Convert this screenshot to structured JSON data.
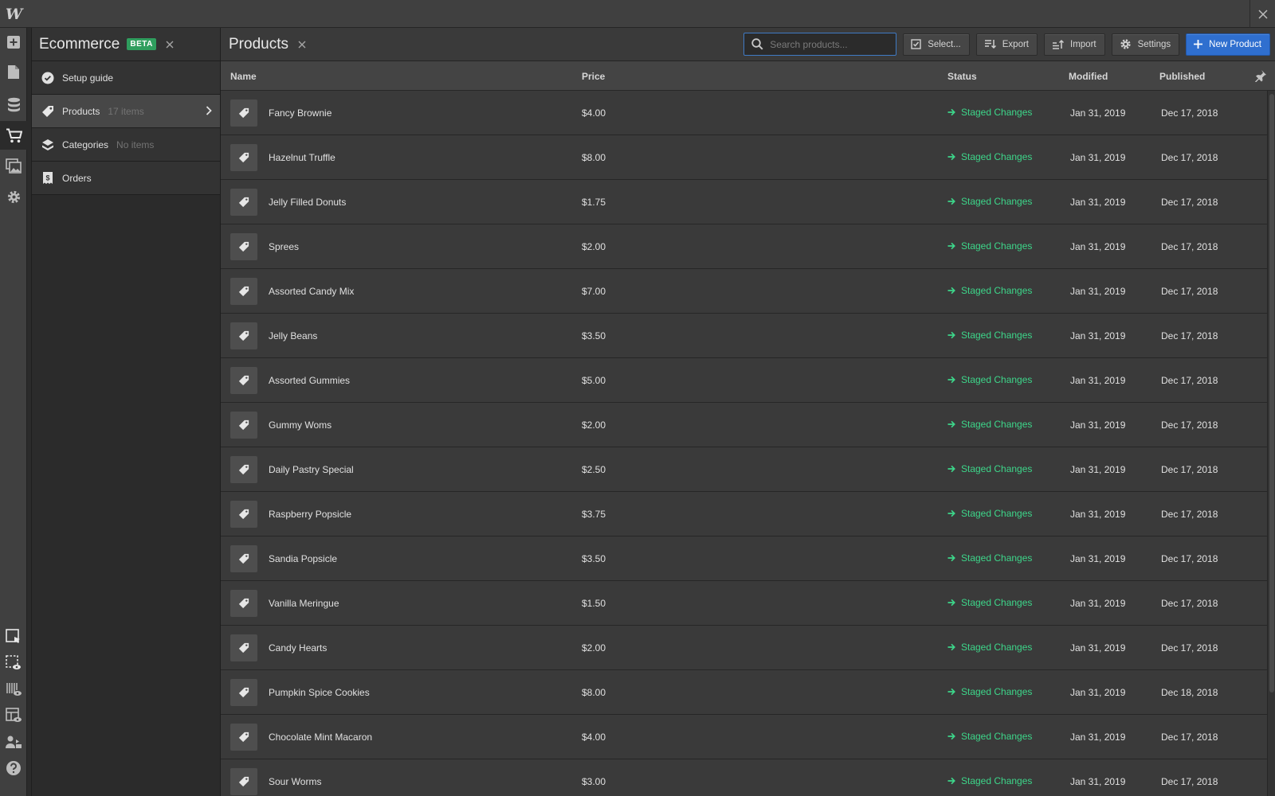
{
  "app": {
    "logo": "W"
  },
  "rail": {
    "icons": [
      "add-icon",
      "pages-icon",
      "cms-icon",
      "ecommerce-icon",
      "assets-icon",
      "settings-icon",
      "select-icon",
      "preview-icon",
      "navigator-icon",
      "layout-icon",
      "audit-icon",
      "help-icon"
    ]
  },
  "panel": {
    "title": "Ecommerce",
    "badge": "BETA",
    "items": [
      {
        "label": "Setup guide",
        "count": ""
      },
      {
        "label": "Products",
        "count": "17 items"
      },
      {
        "label": "Categories",
        "count": "No items"
      },
      {
        "label": "Orders",
        "count": ""
      }
    ]
  },
  "main": {
    "title": "Products",
    "search_placeholder": "Search products...",
    "buttons": {
      "select": "Select...",
      "export": "Export",
      "import": "Import",
      "settings": "Settings",
      "new_product": "New Product"
    }
  },
  "table": {
    "headers": {
      "name": "Name",
      "price": "Price",
      "status": "Status",
      "modified": "Modified",
      "published": "Published"
    },
    "rows": [
      {
        "name": "Fancy Brownie",
        "price": "$4.00",
        "status": "Staged Changes",
        "modified": "Jan 31, 2019",
        "published": "Dec 17, 2018"
      },
      {
        "name": "Hazelnut Truffle",
        "price": "$8.00",
        "status": "Staged Changes",
        "modified": "Jan 31, 2019",
        "published": "Dec 17, 2018"
      },
      {
        "name": "Jelly Filled Donuts",
        "price": "$1.75",
        "status": "Staged Changes",
        "modified": "Jan 31, 2019",
        "published": "Dec 17, 2018"
      },
      {
        "name": "Sprees",
        "price": "$2.00",
        "status": "Staged Changes",
        "modified": "Jan 31, 2019",
        "published": "Dec 17, 2018"
      },
      {
        "name": "Assorted Candy Mix",
        "price": "$7.00",
        "status": "Staged Changes",
        "modified": "Jan 31, 2019",
        "published": "Dec 17, 2018"
      },
      {
        "name": "Jelly Beans",
        "price": "$3.50",
        "status": "Staged Changes",
        "modified": "Jan 31, 2019",
        "published": "Dec 17, 2018"
      },
      {
        "name": "Assorted Gummies",
        "price": "$5.00",
        "status": "Staged Changes",
        "modified": "Jan 31, 2019",
        "published": "Dec 17, 2018"
      },
      {
        "name": "Gummy Woms",
        "price": "$2.00",
        "status": "Staged Changes",
        "modified": "Jan 31, 2019",
        "published": "Dec 17, 2018"
      },
      {
        "name": "Daily Pastry Special",
        "price": "$2.50",
        "status": "Staged Changes",
        "modified": "Jan 31, 2019",
        "published": "Dec 17, 2018"
      },
      {
        "name": "Raspberry Popsicle",
        "price": "$3.75",
        "status": "Staged Changes",
        "modified": "Jan 31, 2019",
        "published": "Dec 17, 2018"
      },
      {
        "name": "Sandia Popsicle",
        "price": "$3.50",
        "status": "Staged Changes",
        "modified": "Jan 31, 2019",
        "published": "Dec 17, 2018"
      },
      {
        "name": "Vanilla Meringue",
        "price": "$1.50",
        "status": "Staged Changes",
        "modified": "Jan 31, 2019",
        "published": "Dec 17, 2018"
      },
      {
        "name": "Candy Hearts",
        "price": "$2.00",
        "status": "Staged Changes",
        "modified": "Jan 31, 2019",
        "published": "Dec 17, 2018"
      },
      {
        "name": "Pumpkin Spice Cookies",
        "price": "$8.00",
        "status": "Staged Changes",
        "modified": "Jan 31, 2019",
        "published": "Dec 18, 2018"
      },
      {
        "name": "Chocolate Mint Macaron",
        "price": "$4.00",
        "status": "Staged Changes",
        "modified": "Jan 31, 2019",
        "published": "Dec 17, 2018"
      },
      {
        "name": "Sour Worms",
        "price": "$3.00",
        "status": "Staged Changes",
        "modified": "Jan 31, 2019",
        "published": "Dec 17, 2018"
      }
    ]
  },
  "colors": {
    "accent": "#2f6fcf",
    "staged": "#3dd68a",
    "beta": "#2f9e5e"
  }
}
